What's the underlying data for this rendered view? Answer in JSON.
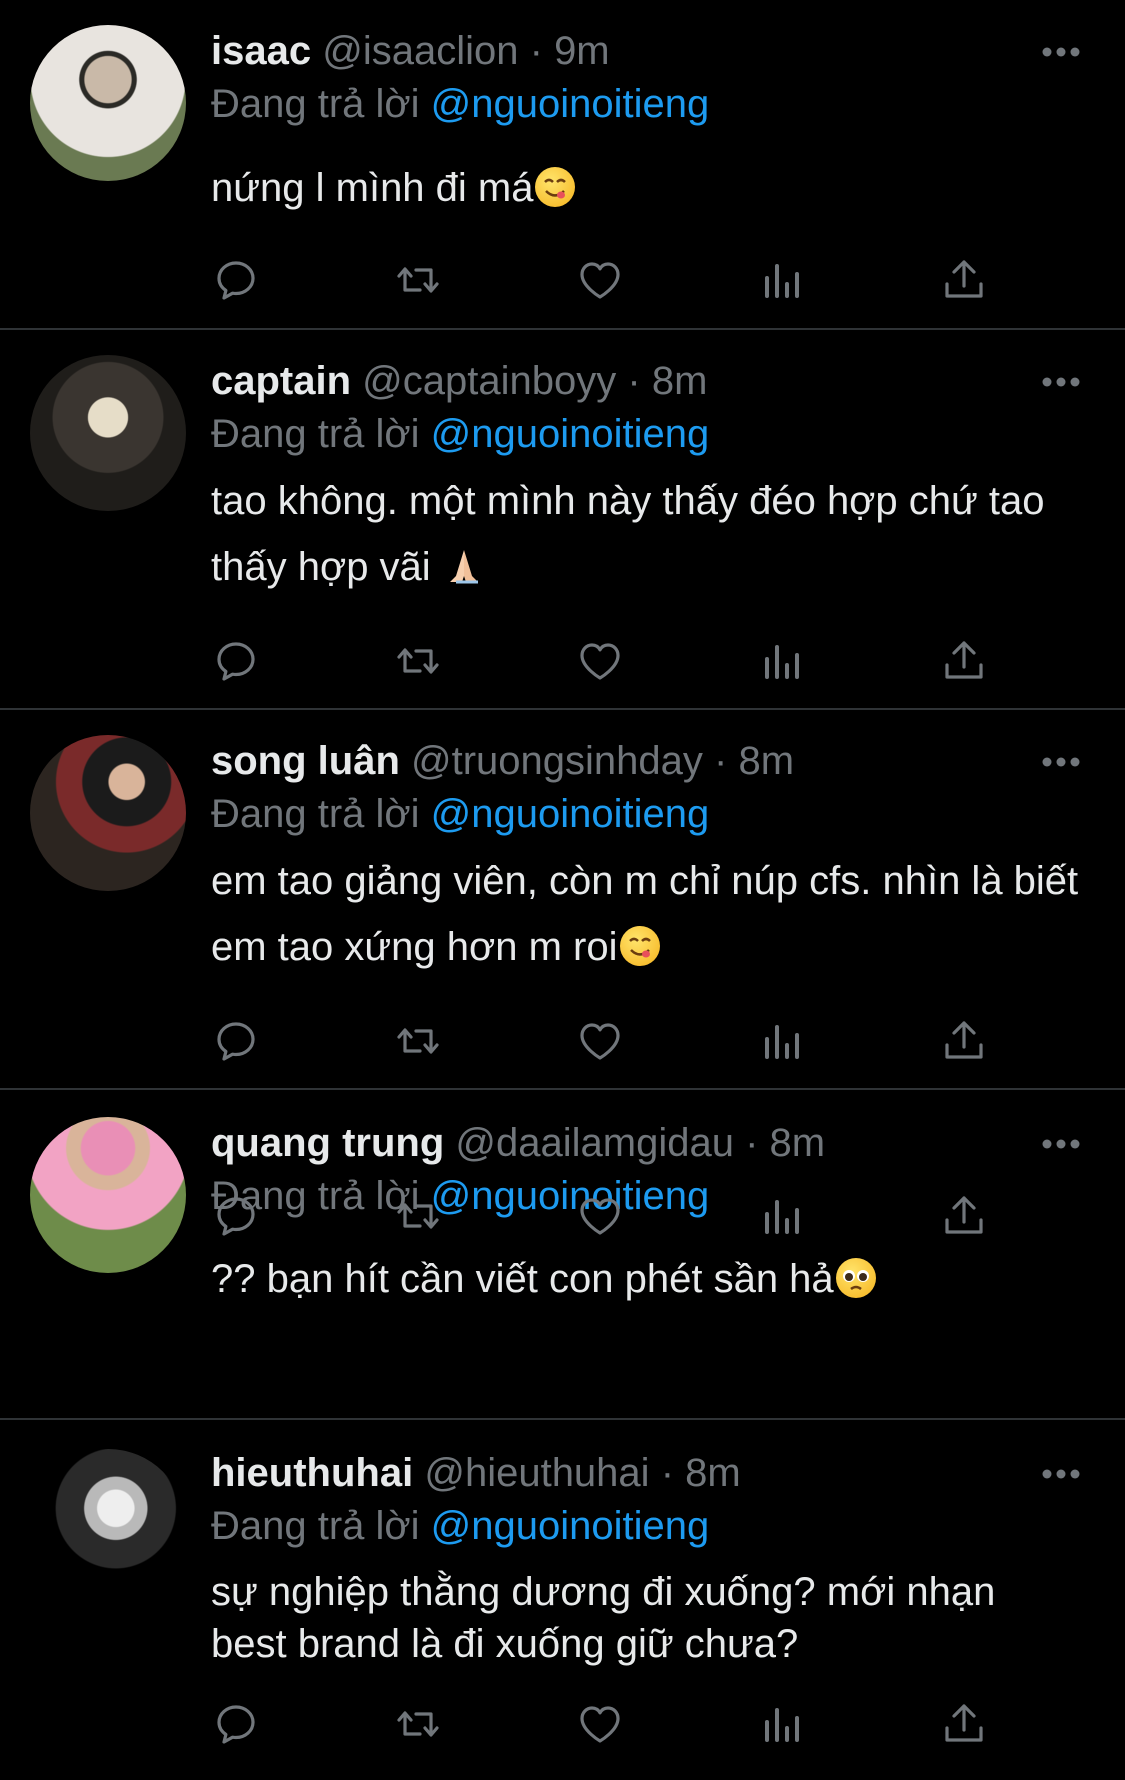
{
  "reply_prefix": "Đang trả lời",
  "colors": {
    "background": "#000000",
    "text": "#e7e9ea",
    "muted": "#71767b",
    "link": "#1d9bf0",
    "divider": "#2f3336"
  },
  "action_icons": [
    "reply-icon",
    "retweet-icon",
    "like-icon",
    "views-icon",
    "share-icon"
  ],
  "tweets": [
    {
      "name": "isaac",
      "handle": "@isaaclion",
      "time": "9m",
      "reply_to": "@nguoinoitieng",
      "text": "nứng l mình đi má",
      "emoji": "yum-face-icon"
    },
    {
      "name": "captain",
      "handle": "@captainboyy",
      "time": "8m",
      "reply_to": "@nguoinoitieng",
      "text": "tao không. một mình này thấy đéo hợp chứ tao thấy hợp vãi",
      "emoji": "folded-hands-icon"
    },
    {
      "name": "song luân",
      "handle": "@truongsinhday",
      "time": "8m",
      "reply_to": "@nguoinoitieng",
      "text": "em tao giảng viên, còn m chỉ núp cfs. nhìn là biết em tao xứng hơn m roi",
      "emoji": "yum-face-icon"
    },
    {
      "name": "quang trung",
      "handle": "@daailamgidau",
      "time": "8m",
      "reply_to": "@nguoinoitieng",
      "text": "?? bạn hít cần viết con phét sần hả",
      "emoji": "pleading-face-icon"
    },
    {
      "name": "hieuthuhai",
      "handle": "@hieuthuhai",
      "time": "8m",
      "reply_to": "@nguoinoitieng",
      "text": "sự nghiệp thằng dương đi xuống? mới nhạn best brand là đi xuống giữ chưa?",
      "emoji": ""
    }
  ]
}
